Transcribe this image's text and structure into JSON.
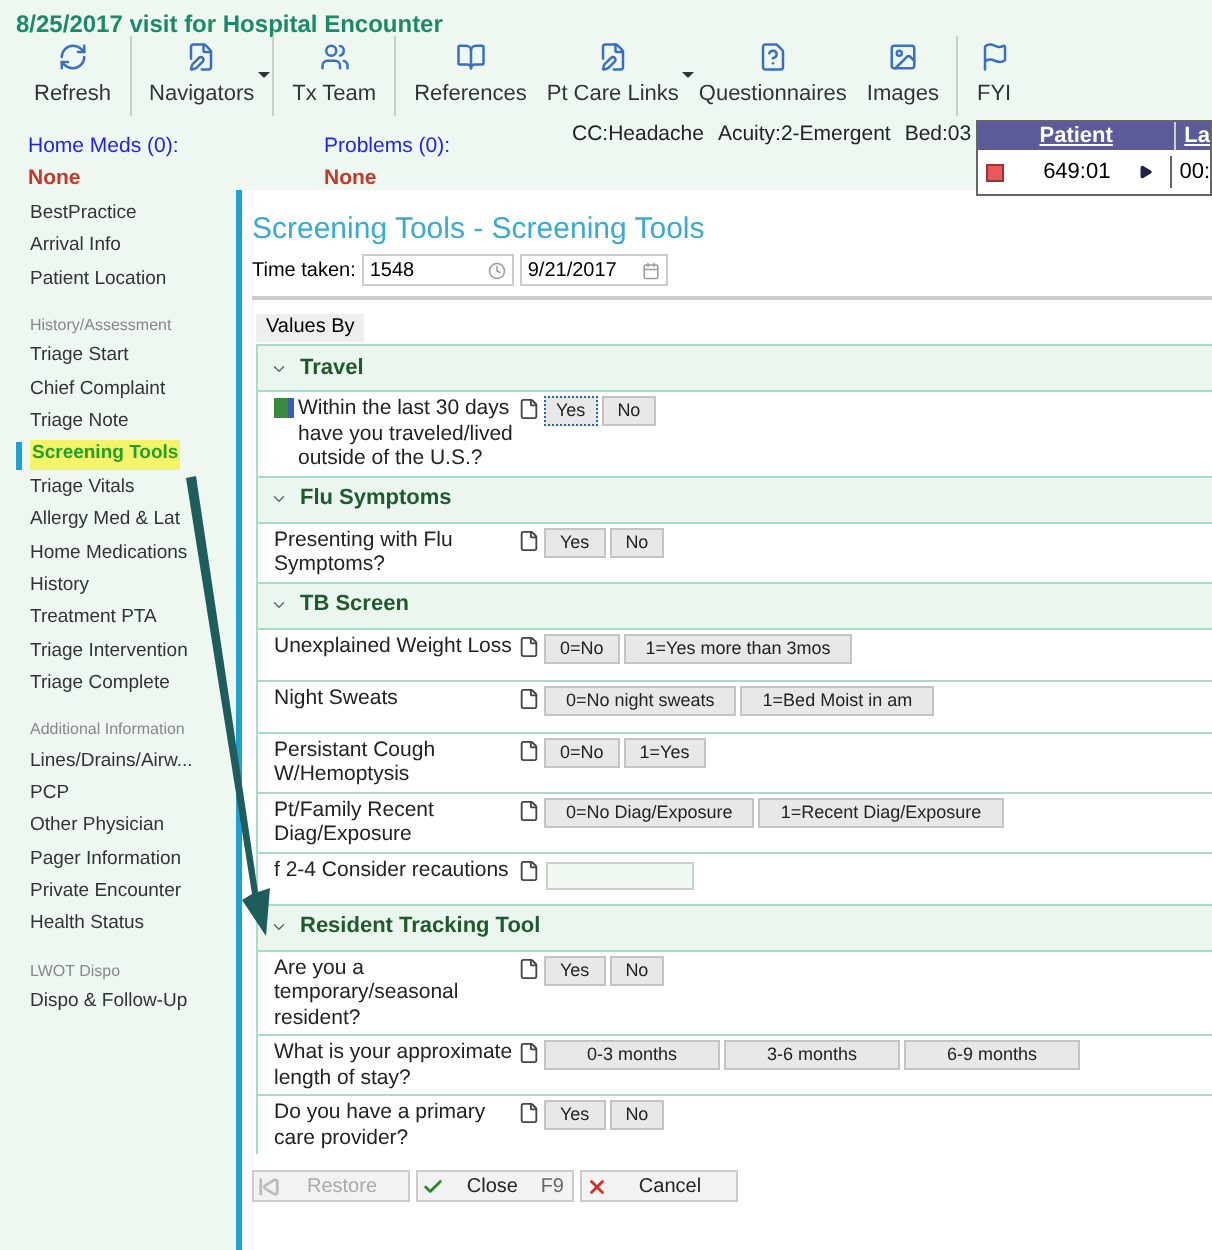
{
  "window": {
    "title": "8/25/2017 visit for Hospital Encounter"
  },
  "toolbar": [
    [
      {
        "label": "Refresh",
        "dropdown": false
      }
    ],
    [
      {
        "label": "Navigators",
        "dropdown": true
      }
    ],
    [
      {
        "label": "Tx Team",
        "dropdown": false
      }
    ],
    [
      {
        "label": "References",
        "dropdown": false
      },
      {
        "label": "Pt Care Links",
        "dropdown": true
      },
      {
        "label": "Questionnaires",
        "dropdown": false
      },
      {
        "label": "Images",
        "dropdown": false
      }
    ],
    [
      {
        "label": "FYI",
        "dropdown": false
      }
    ]
  ],
  "summary": {
    "home_meds": {
      "label": "Home Meds (0):",
      "value": "None"
    },
    "problems": {
      "label": "Problems (0):",
      "value": "None"
    },
    "chief_complaint": "CC:Headache",
    "acuity": "Acuity:2-Emergent",
    "bed": "Bed:03"
  },
  "patient_table": {
    "columns": [
      "Patient",
      "La"
    ],
    "row": [
      "649:01",
      "00:"
    ]
  },
  "sidebar": [
    {
      "items": [
        {
          "label": "BestPractice",
          "selected": false
        },
        {
          "label": "Arrival Info",
          "selected": false
        },
        {
          "label": "Patient Location",
          "selected": false
        }
      ]
    },
    {
      "heading": "History/Assessment",
      "items": [
        {
          "label": "Triage Start",
          "selected": false
        },
        {
          "label": "Chief Complaint",
          "selected": false
        },
        {
          "label": "Triage Note",
          "selected": false
        },
        {
          "label": "Screening Tools",
          "selected": true
        },
        {
          "label": "Triage Vitals",
          "selected": false
        },
        {
          "label": "Allergy Med & Lat",
          "selected": false
        },
        {
          "label": "Home Medications",
          "selected": false
        },
        {
          "label": "History",
          "selected": false
        },
        {
          "label": "Treatment PTA",
          "selected": false
        },
        {
          "label": "Triage Intervention",
          "selected": false
        },
        {
          "label": "Triage Complete",
          "selected": false
        }
      ]
    },
    {
      "heading": "Additional Information",
      "items": [
        {
          "label": "Lines/Drains/Airw...",
          "selected": false
        },
        {
          "label": "PCP",
          "selected": false
        },
        {
          "label": "Other Physician",
          "selected": false
        },
        {
          "label": "Pager Information",
          "selected": false
        },
        {
          "label": "Private Encounter",
          "selected": false
        },
        {
          "label": "Health Status",
          "selected": false
        }
      ]
    },
    {
      "heading": "LWOT Dispo",
      "items": [
        {
          "label": "Dispo & Follow-Up",
          "selected": false
        }
      ]
    }
  ],
  "form": {
    "title": "Screening Tools - Screening Tools",
    "time_label": "Time taken:",
    "time_value": "1548",
    "date_value": "9/21/2017",
    "values_by": "Values By",
    "sections": [
      {
        "title": "Travel",
        "expanded": true,
        "rows": [
          {
            "kind": "choice",
            "label": "Within the last 30 days have you traveled/lived outside of the U.S.?",
            "linked": true,
            "options": [
              {
                "label": "Yes",
                "focused": true
              },
              {
                "label": "No",
                "focused": false
              }
            ]
          }
        ]
      },
      {
        "title": "Flu Symptoms",
        "expanded": true,
        "rows": [
          {
            "kind": "choice",
            "label": "Presenting with Flu Symptoms?",
            "linked": false,
            "options": [
              {
                "label": "Yes",
                "focused": false
              },
              {
                "label": "No",
                "focused": false
              }
            ]
          }
        ]
      },
      {
        "title": "TB Screen",
        "expanded": true,
        "rows": [
          {
            "kind": "choice",
            "label": "Unexplained Weight Loss",
            "linked": false,
            "options": [
              {
                "label": "0=No",
                "focused": false
              },
              {
                "label": "1=Yes more than 3mos",
                "focused": false
              }
            ]
          },
          {
            "kind": "choice",
            "label": "Night Sweats",
            "linked": false,
            "options": [
              {
                "label": "0=No night sweats",
                "focused": false
              },
              {
                "label": "1=Bed Moist in am",
                "focused": false
              }
            ]
          },
          {
            "kind": "choice",
            "label": "Persistant Cough W/Hemoptysis",
            "linked": false,
            "options": [
              {
                "label": "0=No",
                "focused": false
              },
              {
                "label": "1=Yes",
                "focused": false
              }
            ]
          },
          {
            "kind": "choice",
            "label": "Pt/Family Recent Diag/Exposure",
            "linked": false,
            "options": [
              {
                "label": "0=No Diag/Exposure",
                "focused": false
              },
              {
                "label": "1=Recent Diag/Exposure",
                "focused": false
              }
            ]
          },
          {
            "kind": "field",
            "label": "f 2-4 Consider recautions",
            "linked": false
          }
        ]
      },
      {
        "title": "Resident Tracking Tool",
        "expanded": true,
        "rows": [
          {
            "kind": "choice",
            "label": "Are you a temporary/seasonal resident?",
            "linked": false,
            "options": [
              {
                "label": "Yes",
                "focused": false
              },
              {
                "label": "No",
                "focused": false
              }
            ]
          },
          {
            "kind": "choice",
            "label": "What is your approximate length of stay?",
            "linked": false,
            "options": [
              {
                "label": "0-3 months",
                "focused": false
              },
              {
                "label": "3-6 months",
                "focused": false
              },
              {
                "label": "6-9 months",
                "focused": false
              }
            ]
          },
          {
            "kind": "choice",
            "label": "Do you have a primary care provider?",
            "linked": false,
            "options": [
              {
                "label": "Yes",
                "focused": false
              },
              {
                "label": "No",
                "focused": false
              }
            ]
          }
        ]
      }
    ]
  },
  "footer": [
    {
      "kind": "restore",
      "label": "Restore",
      "disabled": true
    },
    {
      "kind": "close",
      "label": "Close",
      "shortcut": "F9",
      "disabled": false
    },
    {
      "kind": "cancel",
      "label": "Cancel",
      "disabled": false
    }
  ]
}
